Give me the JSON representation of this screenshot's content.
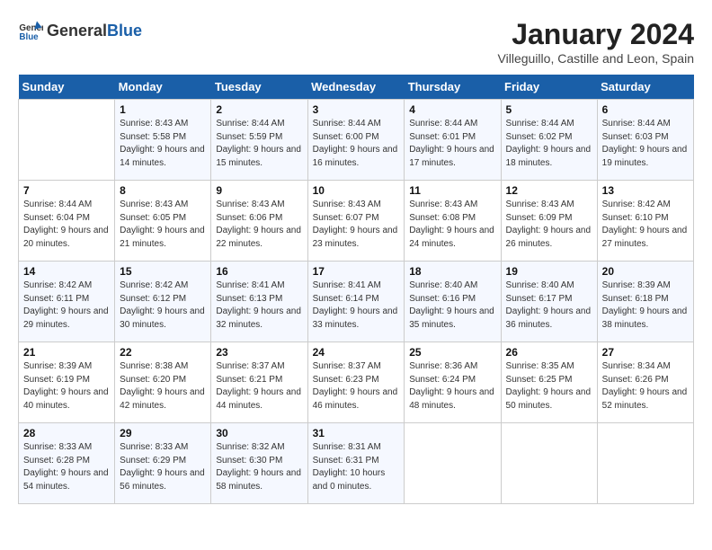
{
  "header": {
    "logo_general": "General",
    "logo_blue": "Blue",
    "title": "January 2024",
    "subtitle": "Villeguillo, Castille and Leon, Spain"
  },
  "weekdays": [
    "Sunday",
    "Monday",
    "Tuesday",
    "Wednesday",
    "Thursday",
    "Friday",
    "Saturday"
  ],
  "weeks": [
    [
      {
        "day": "",
        "sunrise": "",
        "sunset": "",
        "daylight": ""
      },
      {
        "day": "1",
        "sunrise": "Sunrise: 8:43 AM",
        "sunset": "Sunset: 5:58 PM",
        "daylight": "Daylight: 9 hours and 14 minutes."
      },
      {
        "day": "2",
        "sunrise": "Sunrise: 8:44 AM",
        "sunset": "Sunset: 5:59 PM",
        "daylight": "Daylight: 9 hours and 15 minutes."
      },
      {
        "day": "3",
        "sunrise": "Sunrise: 8:44 AM",
        "sunset": "Sunset: 6:00 PM",
        "daylight": "Daylight: 9 hours and 16 minutes."
      },
      {
        "day": "4",
        "sunrise": "Sunrise: 8:44 AM",
        "sunset": "Sunset: 6:01 PM",
        "daylight": "Daylight: 9 hours and 17 minutes."
      },
      {
        "day": "5",
        "sunrise": "Sunrise: 8:44 AM",
        "sunset": "Sunset: 6:02 PM",
        "daylight": "Daylight: 9 hours and 18 minutes."
      },
      {
        "day": "6",
        "sunrise": "Sunrise: 8:44 AM",
        "sunset": "Sunset: 6:03 PM",
        "daylight": "Daylight: 9 hours and 19 minutes."
      }
    ],
    [
      {
        "day": "7",
        "sunrise": "Sunrise: 8:44 AM",
        "sunset": "Sunset: 6:04 PM",
        "daylight": "Daylight: 9 hours and 20 minutes."
      },
      {
        "day": "8",
        "sunrise": "Sunrise: 8:43 AM",
        "sunset": "Sunset: 6:05 PM",
        "daylight": "Daylight: 9 hours and 21 minutes."
      },
      {
        "day": "9",
        "sunrise": "Sunrise: 8:43 AM",
        "sunset": "Sunset: 6:06 PM",
        "daylight": "Daylight: 9 hours and 22 minutes."
      },
      {
        "day": "10",
        "sunrise": "Sunrise: 8:43 AM",
        "sunset": "Sunset: 6:07 PM",
        "daylight": "Daylight: 9 hours and 23 minutes."
      },
      {
        "day": "11",
        "sunrise": "Sunrise: 8:43 AM",
        "sunset": "Sunset: 6:08 PM",
        "daylight": "Daylight: 9 hours and 24 minutes."
      },
      {
        "day": "12",
        "sunrise": "Sunrise: 8:43 AM",
        "sunset": "Sunset: 6:09 PM",
        "daylight": "Daylight: 9 hours and 26 minutes."
      },
      {
        "day": "13",
        "sunrise": "Sunrise: 8:42 AM",
        "sunset": "Sunset: 6:10 PM",
        "daylight": "Daylight: 9 hours and 27 minutes."
      }
    ],
    [
      {
        "day": "14",
        "sunrise": "Sunrise: 8:42 AM",
        "sunset": "Sunset: 6:11 PM",
        "daylight": "Daylight: 9 hours and 29 minutes."
      },
      {
        "day": "15",
        "sunrise": "Sunrise: 8:42 AM",
        "sunset": "Sunset: 6:12 PM",
        "daylight": "Daylight: 9 hours and 30 minutes."
      },
      {
        "day": "16",
        "sunrise": "Sunrise: 8:41 AM",
        "sunset": "Sunset: 6:13 PM",
        "daylight": "Daylight: 9 hours and 32 minutes."
      },
      {
        "day": "17",
        "sunrise": "Sunrise: 8:41 AM",
        "sunset": "Sunset: 6:14 PM",
        "daylight": "Daylight: 9 hours and 33 minutes."
      },
      {
        "day": "18",
        "sunrise": "Sunrise: 8:40 AM",
        "sunset": "Sunset: 6:16 PM",
        "daylight": "Daylight: 9 hours and 35 minutes."
      },
      {
        "day": "19",
        "sunrise": "Sunrise: 8:40 AM",
        "sunset": "Sunset: 6:17 PM",
        "daylight": "Daylight: 9 hours and 36 minutes."
      },
      {
        "day": "20",
        "sunrise": "Sunrise: 8:39 AM",
        "sunset": "Sunset: 6:18 PM",
        "daylight": "Daylight: 9 hours and 38 minutes."
      }
    ],
    [
      {
        "day": "21",
        "sunrise": "Sunrise: 8:39 AM",
        "sunset": "Sunset: 6:19 PM",
        "daylight": "Daylight: 9 hours and 40 minutes."
      },
      {
        "day": "22",
        "sunrise": "Sunrise: 8:38 AM",
        "sunset": "Sunset: 6:20 PM",
        "daylight": "Daylight: 9 hours and 42 minutes."
      },
      {
        "day": "23",
        "sunrise": "Sunrise: 8:37 AM",
        "sunset": "Sunset: 6:21 PM",
        "daylight": "Daylight: 9 hours and 44 minutes."
      },
      {
        "day": "24",
        "sunrise": "Sunrise: 8:37 AM",
        "sunset": "Sunset: 6:23 PM",
        "daylight": "Daylight: 9 hours and 46 minutes."
      },
      {
        "day": "25",
        "sunrise": "Sunrise: 8:36 AM",
        "sunset": "Sunset: 6:24 PM",
        "daylight": "Daylight: 9 hours and 48 minutes."
      },
      {
        "day": "26",
        "sunrise": "Sunrise: 8:35 AM",
        "sunset": "Sunset: 6:25 PM",
        "daylight": "Daylight: 9 hours and 50 minutes."
      },
      {
        "day": "27",
        "sunrise": "Sunrise: 8:34 AM",
        "sunset": "Sunset: 6:26 PM",
        "daylight": "Daylight: 9 hours and 52 minutes."
      }
    ],
    [
      {
        "day": "28",
        "sunrise": "Sunrise: 8:33 AM",
        "sunset": "Sunset: 6:28 PM",
        "daylight": "Daylight: 9 hours and 54 minutes."
      },
      {
        "day": "29",
        "sunrise": "Sunrise: 8:33 AM",
        "sunset": "Sunset: 6:29 PM",
        "daylight": "Daylight: 9 hours and 56 minutes."
      },
      {
        "day": "30",
        "sunrise": "Sunrise: 8:32 AM",
        "sunset": "Sunset: 6:30 PM",
        "daylight": "Daylight: 9 hours and 58 minutes."
      },
      {
        "day": "31",
        "sunrise": "Sunrise: 8:31 AM",
        "sunset": "Sunset: 6:31 PM",
        "daylight": "Daylight: 10 hours and 0 minutes."
      },
      {
        "day": "",
        "sunrise": "",
        "sunset": "",
        "daylight": ""
      },
      {
        "day": "",
        "sunrise": "",
        "sunset": "",
        "daylight": ""
      },
      {
        "day": "",
        "sunrise": "",
        "sunset": "",
        "daylight": ""
      }
    ]
  ]
}
